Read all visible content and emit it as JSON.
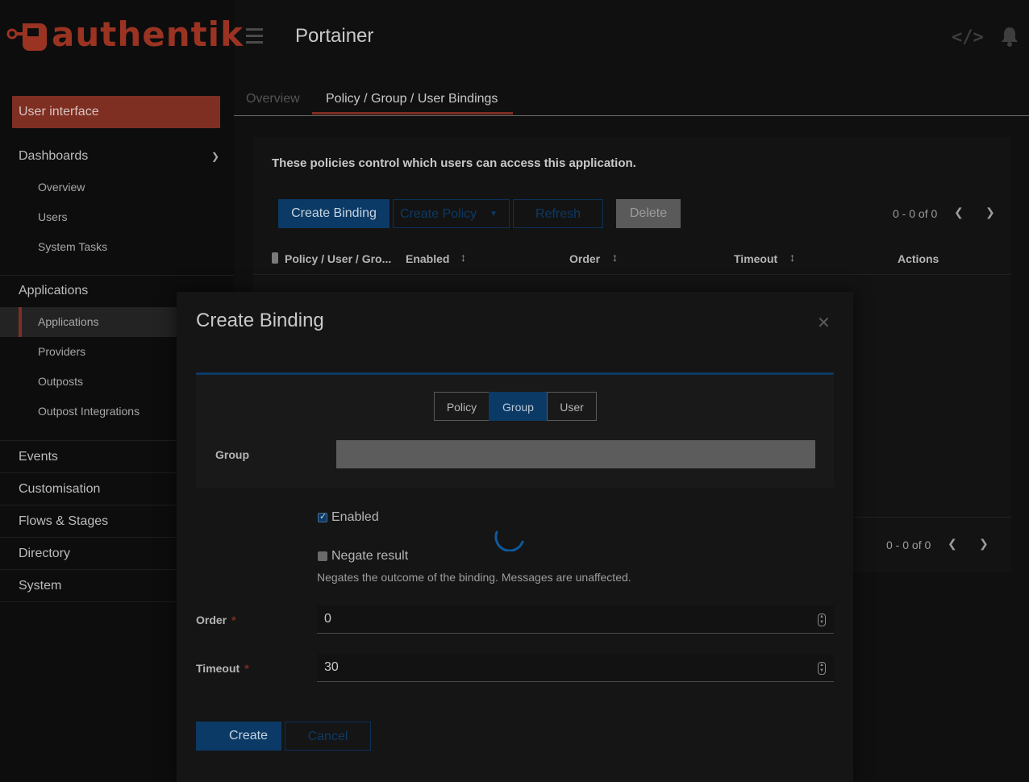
{
  "brand": {
    "logo_text": "authentik",
    "accent": "#7f2e22"
  },
  "sidebar": {
    "user_interface_label": "User interface",
    "dashboards": {
      "label": "Dashboards",
      "items": [
        "Overview",
        "Users",
        "System Tasks"
      ]
    },
    "applications": {
      "label": "Applications",
      "items": [
        "Applications",
        "Providers",
        "Outposts",
        "Outpost Integrations"
      ],
      "active_item": "Applications"
    },
    "sections": [
      "Events",
      "Customisation",
      "Flows & Stages",
      "Directory",
      "System"
    ]
  },
  "header": {
    "title": "Portainer",
    "icons": [
      "menu-icon",
      "code-icon",
      "bell-icon"
    ]
  },
  "tabs": [
    {
      "label": "Overview",
      "active": false
    },
    {
      "label": "Policy / Group / User Bindings",
      "active": true
    }
  ],
  "bindings": {
    "description": "These policies control which users can access this application.",
    "toolbar": {
      "create_binding": "Create Binding",
      "create_policy": "Create Policy",
      "refresh": "Refresh",
      "delete": "Delete"
    },
    "pagination_top": "0 - 0 of 0",
    "pagination_bottom": "0 - 0 of 0",
    "columns": [
      "Policy / User / Gro...",
      "Enabled",
      "Order",
      "Timeout",
      "Actions"
    ]
  },
  "modal": {
    "title": "Create Binding",
    "binding_types": [
      "Policy",
      "Group",
      "User"
    ],
    "selected_type": "Group",
    "group_label": "Group",
    "enabled_label": "Enabled",
    "enabled_checked": true,
    "negate_label": "Negate result",
    "negate_checked": false,
    "negate_help": "Negates the outcome of the binding. Messages are unaffected.",
    "order_label": "Order",
    "order_value": "0",
    "timeout_label": "Timeout",
    "timeout_value": "30",
    "required_mark": "*",
    "create_button": "Create",
    "cancel_button": "Cancel"
  },
  "colors": {
    "primary": "#0c3a66",
    "background": "#101010",
    "accent": "#7f2e22"
  }
}
